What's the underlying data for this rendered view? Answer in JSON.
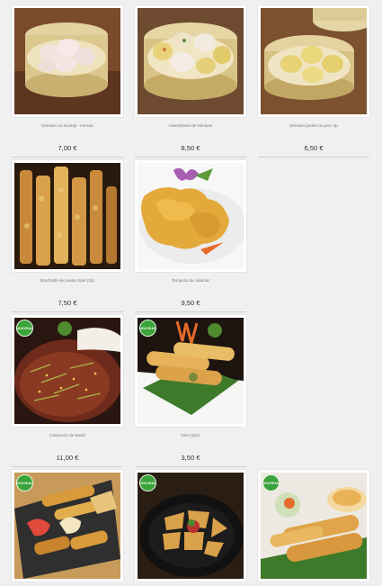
{
  "colors": {
    "page_bg": "#f1f0f0",
    "badge_green": "#3aa33a",
    "rule": "#cfcfcf"
  },
  "badge_label": "NOUVEAU",
  "products": [
    {
      "name": "Dimsum au scampi - Ha sao",
      "price": "7,00 €",
      "image": "steamer-shrimp-dumplings",
      "new": false
    },
    {
      "name": "Assortiment de Dimsum",
      "price": "8,50 €",
      "image": "steamer-assorted-dimsum",
      "new": false
    },
    {
      "name": "Dimsum poulet ou porc 4p",
      "price": "6,50 €",
      "image": "steamer-pork-dumplings",
      "new": false
    },
    {
      "name": "Brochette de poulet Saté (3p)",
      "price": "7,50 €",
      "image": "chicken-skewers",
      "new": false
    },
    {
      "name": "Tempura de calamar",
      "price": "9,50 €",
      "image": "calamari-tempura",
      "new": false
    },
    {
      "name": "Carpaccio de Bœuf",
      "price": "11,00 €",
      "image": "beef-carpaccio",
      "new": true
    },
    {
      "name": "Nem (2pc)",
      "price": "3,50 €",
      "image": "spring-rolls",
      "new": true
    },
    {
      "name": "",
      "price": "",
      "image": "appetizer-platter",
      "new": true
    },
    {
      "name": "",
      "price": "",
      "image": "fried-tofu-plate",
      "new": true
    },
    {
      "name": "",
      "price": "",
      "image": "fried-rolls-with-sauce",
      "new": true
    }
  ]
}
